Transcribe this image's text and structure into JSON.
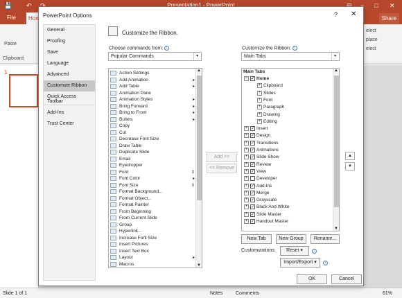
{
  "window": {
    "title": "Presentation1 - PowerPoint",
    "minimize_icon": "−",
    "maximize_icon": "□",
    "close_icon": "✕",
    "ribbon_display_icon": "⊟"
  },
  "qat": {
    "save": "💾",
    "undo": "↶",
    "redo": "↷"
  },
  "ribbon_tabs": {
    "file": "File",
    "home": "Hom",
    "share": "Share"
  },
  "ribbon": {
    "paste": "Paste",
    "clipboard": "Clipboard",
    "right1": "elect",
    "right2": "place",
    "right3": "elect"
  },
  "slide_pane": {
    "number": "1"
  },
  "statusbar": {
    "slide": "Slide 1 of 1",
    "notes": "Notes",
    "comments": "Comments",
    "zoom": "61%"
  },
  "dialog": {
    "title": "PowerPoint Options",
    "help_icon": "?",
    "close_icon": "✕",
    "nav": [
      "General",
      "Proofing",
      "Save",
      "Language",
      "Advanced",
      "Customize Ribbon",
      "Quick Access Toolbar",
      "Add-Ins",
      "Trust Center"
    ],
    "heading": "Customize the Ribbon.",
    "choose_label": "Choose commands from:",
    "choose_value": "Popular Commands",
    "customize_label": "Customize the Ribbon:",
    "customize_value": "Main Tabs",
    "commands": [
      "Action Settings",
      "Add Animation",
      "Add Table",
      "Animation Pane",
      "Animation Styles",
      "Bring Forward",
      "Bring to Front",
      "Bullets",
      "Copy",
      "Cut",
      "Decrease Font Size",
      "Draw Table",
      "Duplicate Slide",
      "Email",
      "Eyedropper",
      "Font",
      "Font Color",
      "Font Size",
      "Format Background...",
      "Format Object...",
      "Format Painter",
      "From Beginning",
      "From Current Slide",
      "Group",
      "Hyperlink...",
      "Increase Font Size",
      "Insert Pictures",
      "Insert Text Box",
      "Layout",
      "Macros"
    ],
    "commands_with_submenu": [
      1,
      2,
      4,
      5,
      6,
      7,
      16,
      28
    ],
    "commands_with_combo": [
      15,
      17
    ],
    "tree_header": "Main Tabs",
    "tree": [
      {
        "label": "Home",
        "level": 0,
        "exp": "−",
        "checked": true,
        "bold": true
      },
      {
        "label": "Clipboard",
        "level": 1,
        "exp": "+"
      },
      {
        "label": "Slides",
        "level": 1,
        "exp": "+"
      },
      {
        "label": "Font",
        "level": 1,
        "exp": "+"
      },
      {
        "label": "Paragraph",
        "level": 1,
        "exp": "+"
      },
      {
        "label": "Drawing",
        "level": 1,
        "exp": "+"
      },
      {
        "label": "Editing",
        "level": 1,
        "exp": "+"
      },
      {
        "label": "Insert",
        "level": 0,
        "exp": "+",
        "checked": true
      },
      {
        "label": "Design",
        "level": 0,
        "exp": "+",
        "checked": true
      },
      {
        "label": "Transitions",
        "level": 0,
        "exp": "+",
        "checked": true
      },
      {
        "label": "Animations",
        "level": 0,
        "exp": "+",
        "checked": true
      },
      {
        "label": "Slide Show",
        "level": 0,
        "exp": "+",
        "checked": true
      },
      {
        "label": "Review",
        "level": 0,
        "exp": "+",
        "checked": true
      },
      {
        "label": "View",
        "level": 0,
        "exp": "+",
        "checked": true
      },
      {
        "label": "Developer",
        "level": 0,
        "exp": "+",
        "checked": false
      },
      {
        "label": "Add-Ins",
        "level": 0,
        "exp": "+",
        "checked": true
      },
      {
        "label": "Merge",
        "level": 0,
        "exp": "+",
        "checked": true
      },
      {
        "label": "Grayscale",
        "level": 0,
        "exp": "+",
        "checked": true
      },
      {
        "label": "Black And White",
        "level": 0,
        "exp": "+",
        "checked": true
      },
      {
        "label": "Slide Master",
        "level": 0,
        "exp": "+",
        "checked": true
      },
      {
        "label": "Handout Master",
        "level": 0,
        "exp": "+",
        "checked": true
      }
    ],
    "add_button": "Add >>",
    "remove_button": "<< Remove",
    "move_up": "▲",
    "move_down": "▼",
    "new_tab": "New Tab",
    "new_group": "New Group",
    "rename": "Rename...",
    "customizations_label": "Customizations:",
    "reset": "Reset",
    "import_export": "Import/Export",
    "ok": "OK",
    "cancel": "Cancel",
    "info_icon": "i",
    "dropdown_icon": "▾"
  },
  "colors": {
    "accent": "#b7472a",
    "selection": "#c8c8c8"
  }
}
